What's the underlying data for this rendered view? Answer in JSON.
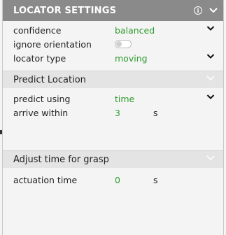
{
  "header": {
    "title": "LOCATOR SETTINGS",
    "info_icon": "ⓘ",
    "chevron_icon": "chevron-down-icon"
  },
  "locator": {
    "confidence": {
      "label": "confidence",
      "value": "balanced"
    },
    "ignore_orientation": {
      "label": "ignore orientation",
      "enabled": false
    },
    "locator_type": {
      "label": "locator type",
      "value": "moving"
    }
  },
  "predict_location": {
    "title": "Predict Location",
    "predict_using": {
      "label": "predict using",
      "value": "time"
    },
    "arrive_within": {
      "label": "arrive within",
      "value": "3",
      "unit": "s"
    }
  },
  "adjust_time": {
    "title": "Adjust time for grasp",
    "actuation_time": {
      "label": "actuation time",
      "value": "0",
      "unit": "s"
    }
  },
  "colors": {
    "header_bg": "#8a8a8a",
    "value_green": "#2e9b2e",
    "section_bg": "#e4e4e4"
  }
}
